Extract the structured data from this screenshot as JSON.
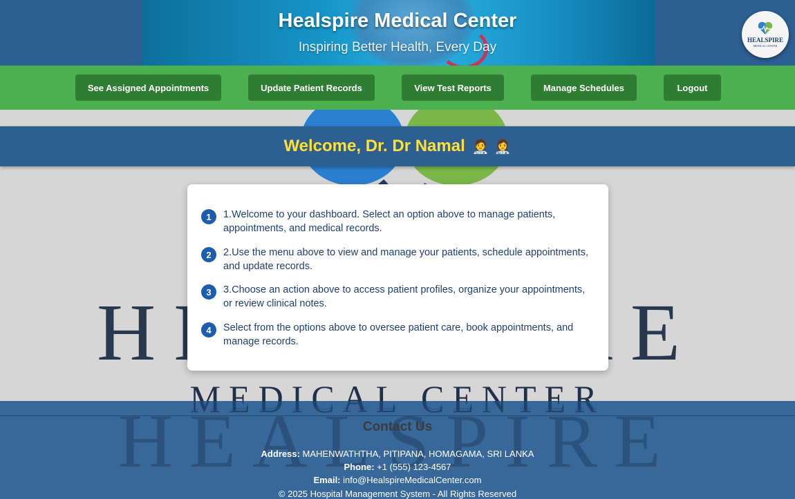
{
  "header": {
    "title": "Healspire Medical Center",
    "subtitle": "Inspiring Better Health, Every Day",
    "logo_text": "HEALSPIRE",
    "logo_subtext": "MEDICAL CENTER"
  },
  "nav": {
    "items": [
      {
        "label": "See Assigned Appointments"
      },
      {
        "label": "Update Patient Records"
      },
      {
        "label": "View Test Reports"
      },
      {
        "label": "Manage Schedules"
      },
      {
        "label": "Logout"
      }
    ]
  },
  "background": {
    "word1": "HEALSPIRE",
    "word2": "MEDICAL CENTER"
  },
  "welcome": {
    "text": "Welcome, Dr. Dr Namal",
    "emoji": "🧑‍⚕️ 👩‍⚕️"
  },
  "steps": [
    {
      "num": "1",
      "text": "1.Welcome to your dashboard. Select an option above to manage patients, appointments, and medical records."
    },
    {
      "num": "2",
      "text": "2.Use the menu above to view and manage your patients, schedule appointments, and update records."
    },
    {
      "num": "3",
      "text": "3.Choose an action above to access patient profiles, organize your appointments, or review clinical notes."
    },
    {
      "num": "4",
      "text": "Select from the options above to oversee patient care, book appointments, and manage records."
    }
  ],
  "footer": {
    "title": "Contact Us",
    "address_label": "Address:",
    "address": "MAHENWATHTHA, PITIPANA, HOMAGAMA, SRI LANKA",
    "phone_label": "Phone:",
    "phone": "+1 (555) 123-4567",
    "email_label": "Email:",
    "email": "info@HealspireMedicalCenter.com",
    "copyright": "© 2025 Hospital Management System - All Rights Reserved"
  },
  "colors": {
    "header_bg": "#2d5f93",
    "nav_bg": "#4caf50",
    "nav_button": "#2e7d32",
    "welcome_text": "#ffe033",
    "step_badge": "#1c5dae"
  }
}
